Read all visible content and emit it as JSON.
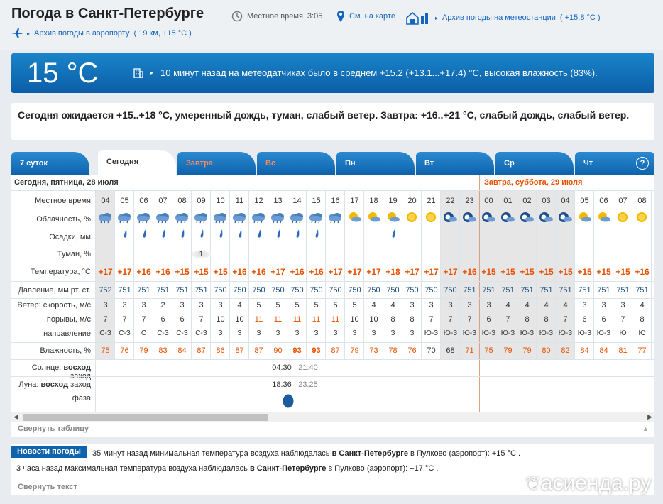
{
  "header": {
    "title": "Погода в Санкт-Петербурге",
    "local_time_label": "Местное время",
    "local_time": "3:05",
    "map_link": "См. на карте",
    "archive_station": "Архив погоды на метеостанции",
    "archive_station_temp": "( +15.8 °C )",
    "archive_airport": "Архив погоды в аэропорту",
    "archive_airport_info": "( 19 км, +15 °C )"
  },
  "now": {
    "temp": "15 °C",
    "text": "10 минут назад на метеодатчиках было в среднем +15.2 (+13.1...+17.4) °C, высокая влажность (83%)."
  },
  "forecast_text": "Сегодня ожидается +15..+18 °C, умеренный дождь, туман, слабый ветер. Завтра: +16..+21 °C, слабый дождь, слабый ветер.",
  "tabs": [
    "7 суток",
    "Сегодня",
    "Завтра",
    "Вс",
    "Пн",
    "Вт",
    "Ср",
    "Чт"
  ],
  "help": "?",
  "day1": "Сегодня, пятница, 28 июля",
  "day2": "Завтра, суббота, 29 июля",
  "labels": {
    "time": "Местное время",
    "clouds": "Облачность, %",
    "precip": "Осадки, мм",
    "fog": "Туман, %",
    "temp": "Температура, °C",
    "pressure": "Давление, мм рт. ст.",
    "wind": "Ветер: скорость, м/с",
    "gusts": "порывы, м/с",
    "dir": "направление",
    "humidity": "Влажность, %",
    "sun_prefix": "Солнце:",
    "sun_rise": "восход",
    "sun_set": "заход",
    "moon_prefix": "Луна:",
    "moon_rise": "восход",
    "moon_set": "заход",
    "phase": "фаза"
  },
  "hours": [
    "04",
    "05",
    "06",
    "07",
    "08",
    "09",
    "10",
    "11",
    "12",
    "13",
    "14",
    "15",
    "16",
    "17",
    "18",
    "19",
    "20",
    "21",
    "22",
    "23",
    "00",
    "01",
    "02",
    "03",
    "04",
    "05",
    "06",
    "07",
    "08"
  ],
  "clouds": [
    "rain",
    "rain",
    "rain",
    "rain",
    "rain",
    "rain",
    "rain",
    "rain",
    "rain",
    "rain",
    "rain",
    "rain",
    "rain",
    "psun",
    "psun",
    "psun",
    "sun",
    "sun",
    "night",
    "night",
    "night",
    "night",
    "night",
    "night",
    "night",
    "psun",
    "psun",
    "sun",
    "sun"
  ],
  "precip": [
    0,
    1,
    1,
    1,
    1,
    1,
    1,
    1,
    1,
    1,
    1,
    1,
    0,
    0,
    0,
    1,
    0,
    0,
    0,
    0,
    0,
    0,
    0,
    0,
    0,
    0,
    0,
    0,
    0
  ],
  "fog": "1",
  "temps": [
    "+17",
    "+17",
    "+16",
    "+16",
    "+15",
    "+15",
    "+15",
    "+16",
    "+16",
    "+17",
    "+16",
    "+16",
    "+17",
    "+17",
    "+17",
    "+18",
    "+17",
    "+17",
    "+17",
    "+16",
    "+15",
    "+15",
    "+15",
    "+15",
    "+15",
    "+15",
    "+15",
    "+15",
    "+16"
  ],
  "pressure": [
    "752",
    "751",
    "751",
    "751",
    "751",
    "751",
    "750",
    "750",
    "750",
    "750",
    "750",
    "750",
    "750",
    "750",
    "750",
    "750",
    "750",
    "750",
    "750",
    "751",
    "751",
    "751",
    "751",
    "751",
    "751",
    "751",
    "751",
    "751",
    "751"
  ],
  "wind": [
    "3",
    "3",
    "3",
    "2",
    "3",
    "3",
    "3",
    "4",
    "5",
    "5",
    "5",
    "5",
    "5",
    "5",
    "4",
    "4",
    "3",
    "3",
    "3",
    "3",
    "3",
    "4",
    "4",
    "4",
    "4",
    "3",
    "3",
    "3",
    "4"
  ],
  "gusts": [
    "7",
    "7",
    "7",
    "6",
    "6",
    "7",
    "10",
    "10",
    "11",
    "11",
    "11",
    "11",
    "11",
    "10",
    "10",
    "8",
    "8",
    "7",
    "7",
    "7",
    "6",
    "7",
    "8",
    "8",
    "7",
    "6",
    "6",
    "7",
    "8"
  ],
  "dirs": [
    "С-З",
    "С-З",
    "С",
    "С-З",
    "С-З",
    "С-З",
    "З",
    "З",
    "З",
    "З",
    "З",
    "З",
    "З",
    "З",
    "З",
    "З",
    "З",
    "Ю-З",
    "Ю-З",
    "Ю-З",
    "Ю-З",
    "Ю-З",
    "Ю-З",
    "Ю-З",
    "Ю-З",
    "Ю-З",
    "Ю-З",
    "Ю",
    "Ю"
  ],
  "humidity": [
    "75",
    "76",
    "79",
    "83",
    "84",
    "87",
    "86",
    "87",
    "87",
    "90",
    "93",
    "93",
    "87",
    "79",
    "73",
    "78",
    "76",
    "70",
    "68",
    "71",
    "75",
    "79",
    "79",
    "80",
    "82",
    "84",
    "84",
    "81",
    "77"
  ],
  "sun": {
    "rise": "04:30",
    "set": "21:40"
  },
  "moon": {
    "rise": "18:36",
    "set": "23:25"
  },
  "collapse_table": "Свернуть таблицу",
  "news": {
    "tag": "Новости погоды",
    "line1_pre": "35 минут назад минимальная температура воздуха наблюдалась",
    "line1_city": "в Санкт-Петербурге",
    "line1_post": "в Пулково (аэропорт): +15 °C .",
    "line2_pre": "3 часа назад максимальная температура воздуха наблюдалась",
    "line2_city": "в Санкт-Петербурге",
    "line2_post": "в Пулково (аэропорт): +17 °C .",
    "collapse": "Свернуть текст"
  },
  "watermark": "асиенда.ру",
  "colors": {
    "accent": "#0e63ac",
    "temp": "#e65100",
    "weekend": "#ff8a5c",
    "night": "#e6e6e6"
  }
}
